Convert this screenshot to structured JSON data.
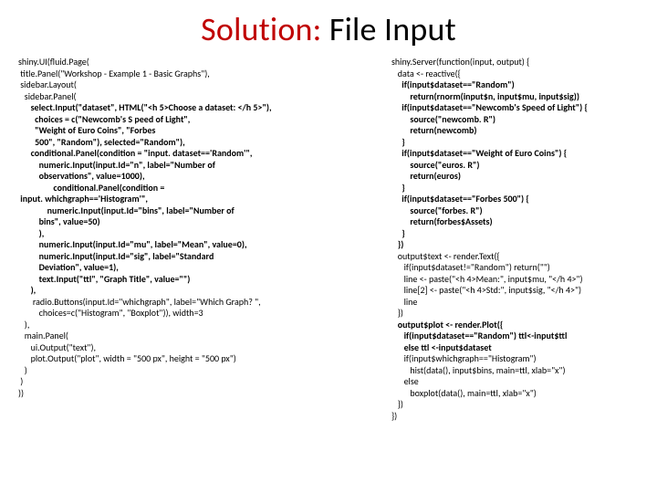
{
  "title": {
    "highlight": "Solution:",
    "rest": " File Input"
  },
  "left_code": [
    "shiny.UI(fluid.Page(",
    " title.Panel(\"Workshop - Example 1 - Basic Graphs\"),",
    " sidebar.Layout(",
    "   sidebar.Panel(",
    "      select.Input(\"dataset\", HTML(\"<h 5>Choose a dataset: </h 5>\"),",
    "        choices = c(\"Newcomb's S peed of Light\",",
    "        \"Weight of Euro Coins\", \"Forbes",
    "        500\", \"Random\"), selected=\"Random\"),",
    "      conditional.Panel(condition = \"input. dataset=='Random'\",",
    "          numeric.Input(input.Id=\"n\", label=\"Number of",
    "          observations\", value=1000),",
    "                 conditional.Panel(condition =",
    " input. whichgraph=='Histogram'\",",
    "              numeric.Input(input.Id=\"bins\", label=\"Number of",
    "          bins\", value=50)",
    "          ),",
    "          numeric.Input(input.Id=\"mu\", label=\"Mean\", value=0),",
    "          numeric.Input(input.Id=\"sig\", label=\"Standard",
    "          Deviation\", value=1),",
    "          text.Input(\"ttl\", \"Graph Title\", value=\"\")",
    "      ),",
    "       radio.Buttons(input.Id=\"whichgraph\", label=\"Which Graph? \",",
    "          choices=c(\"Histogram\", \"Boxplot\")), width=3",
    "   ),",
    "   main.Panel(",
    "      ui.Output(\"text\"),",
    "      plot.Output(\"plot\", width = \"500 px\", height = \"500 px\")",
    "   )",
    " )",
    "))"
  ],
  "right_code": [
    "shiny.Server(function(input, output) {",
    "   data <- reactive({",
    "     if(input$dataset==\"Random\")",
    "         return(rnorm(input$n, input$mu, input$sig))",
    "     if(input$dataset==\"Newcomb's Speed of Light\") {",
    "         source(\"newcomb. R\")",
    "         return(newcomb)",
    "     }",
    "     if(input$dataset==\"Weight of Euro Coins\") {",
    "         source(\"euros. R\")",
    "         return(euros)",
    "     }",
    "     if(input$dataset==\"Forbes 500\") {",
    "         source(\"forbes. R\")",
    "         return(forbes$Assets)",
    "     }",
    "   })",
    "   output$text <- render.Text({",
    "      if(input$dataset!=\"Random\") return(\"\")",
    "      line <- paste(\"<h 4>Mean:\", input$mu, \"</h 4>\")",
    "      line[2] <- paste(\"<h 4>Std:\", input$sig, \"</h 4>\")",
    "      line",
    "   })",
    "   output$plot <- render.Plot({",
    "      if(input$dataset==\"Random\") ttl<-input$ttl",
    "      else ttl <-input$dataset",
    "      if(input$whichgraph==\"Histogram\")",
    "         hist(data(), input$bins, main=ttl, xlab=\"x\")",
    "      else",
    "         boxplot(data(), main=ttl, xlab=\"x\")",
    "   })",
    "})"
  ],
  "bold_lines": {
    "left": [
      4,
      5,
      6,
      7,
      8,
      9,
      10,
      11,
      12,
      13,
      14,
      15,
      16,
      17,
      18,
      19,
      20
    ],
    "right": [
      2,
      3,
      4,
      5,
      6,
      7,
      8,
      9,
      10,
      11,
      12,
      13,
      14,
      15,
      16,
      23,
      24,
      25
    ]
  }
}
